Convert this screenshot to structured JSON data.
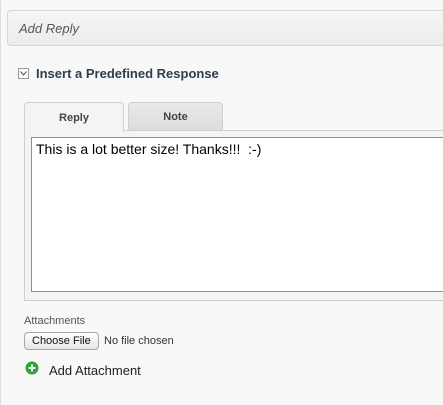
{
  "header": {
    "title": "Add Reply"
  },
  "predefined": {
    "label": "Insert a Predefined Response",
    "toggle_icon": "chevron-down-icon"
  },
  "tabs": [
    {
      "label": "Reply",
      "active": true
    },
    {
      "label": "Note",
      "active": false
    }
  ],
  "reply": {
    "text": "This is a lot better size! Thanks!!!  :-)"
  },
  "attachments": {
    "label": "Attachments",
    "choose_button": "Choose File",
    "no_file_text": "No file chosen",
    "add_label": "Add Attachment",
    "add_icon": "plus-circle-icon",
    "add_icon_color": "#2aa33a"
  }
}
